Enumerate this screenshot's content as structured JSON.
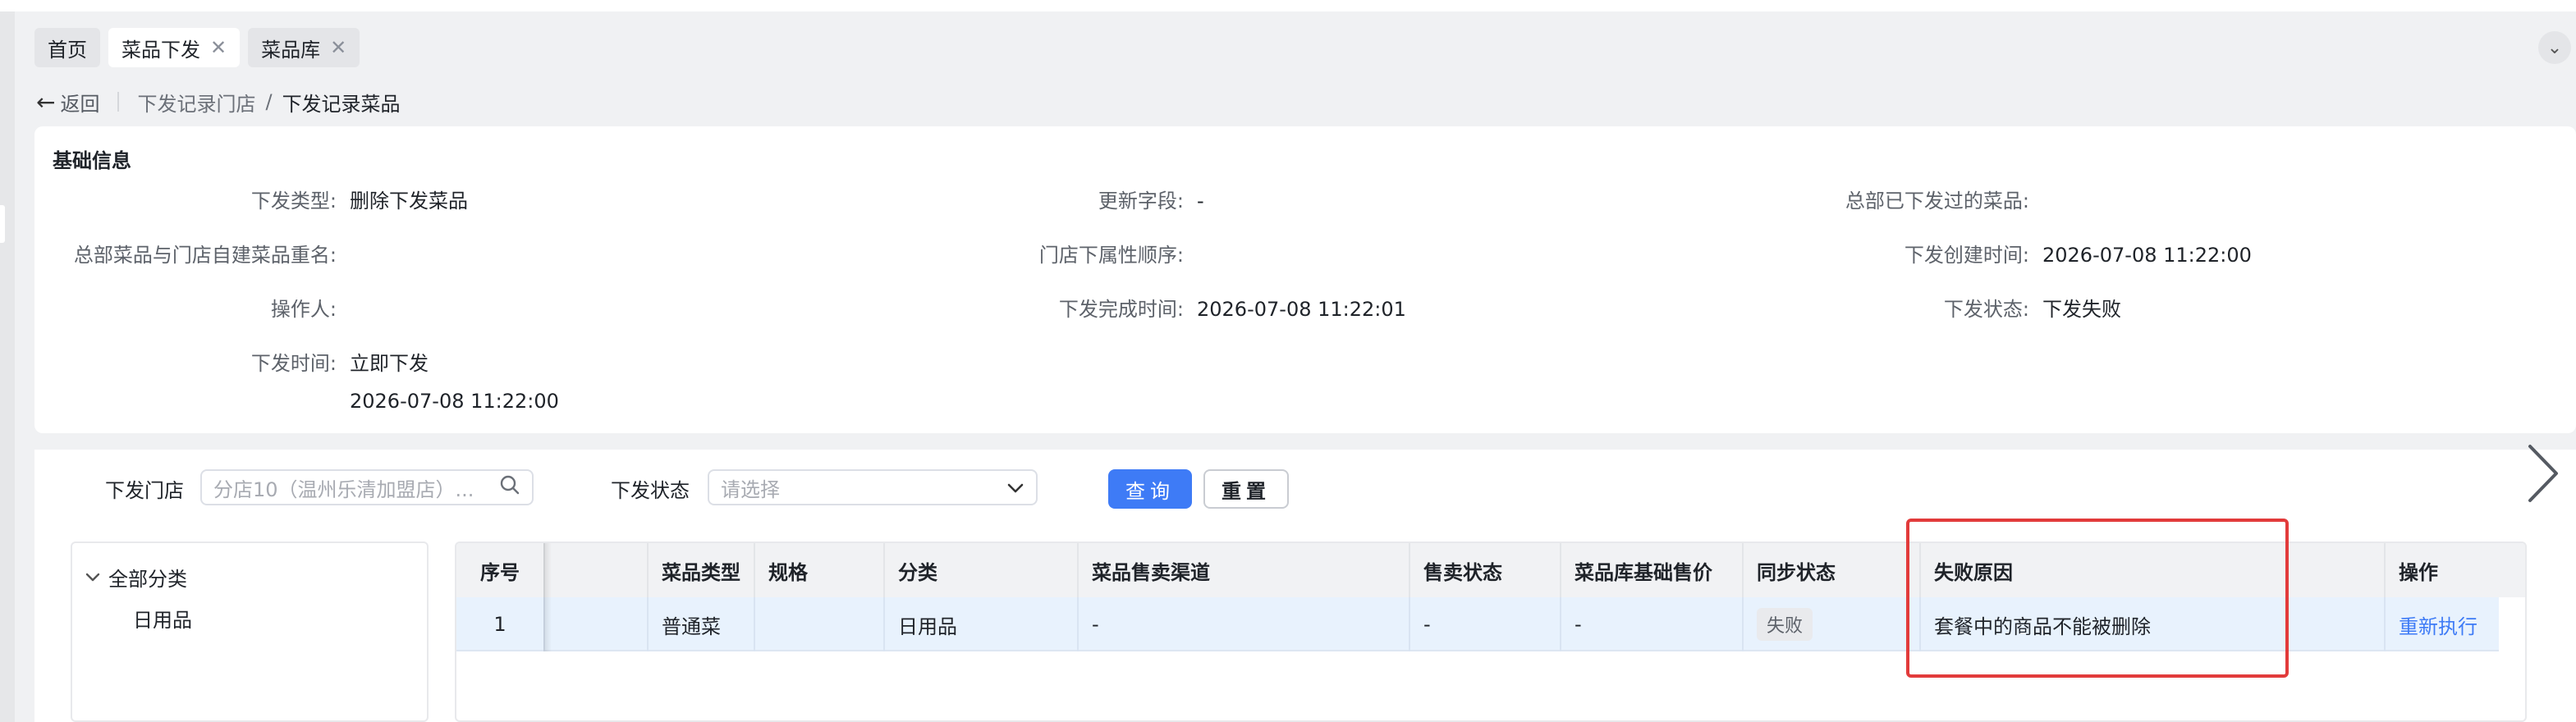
{
  "tabs": [
    {
      "label": "首页",
      "closable": false
    },
    {
      "label": "菜品下发",
      "closable": true
    },
    {
      "label": "菜品库",
      "closable": true
    }
  ],
  "breadcrumb": {
    "back_label": "返回",
    "parent": "下发记录门店",
    "separator": "/",
    "current": "下发记录菜品"
  },
  "basic_info": {
    "title": "基础信息",
    "fields": {
      "dispatch_type": {
        "label": "下发类型:",
        "value": "删除下发菜品"
      },
      "update_fields": {
        "label": "更新字段:",
        "value": "-"
      },
      "hq_dispatched_dishes": {
        "label": "总部已下发过的菜品:",
        "value": ""
      },
      "rename_conflict": {
        "label": "总部菜品与门店自建菜品重名:",
        "value": ""
      },
      "store_attr_order": {
        "label": "门店下属性顺序:",
        "value": ""
      },
      "created_time": {
        "label": "下发创建时间:",
        "value": "2026-07-08 11:22:00"
      },
      "operator": {
        "label": "操作人:",
        "value": ""
      },
      "finished_time": {
        "label": "下发完成时间:",
        "value": "2026-07-08 11:22:01"
      },
      "status": {
        "label": "下发状态:",
        "value": "下发失败"
      },
      "dispatch_time": {
        "label": "下发时间:",
        "value_line1": "立即下发",
        "value_line2": "2026-07-08 11:22:00"
      }
    }
  },
  "filters": {
    "store_label": "下发门店",
    "store_value": "分店10（温州乐清加盟店）...",
    "status_label": "下发状态",
    "status_placeholder": "请选择",
    "query_button": "查询",
    "reset_button": "重置"
  },
  "category_tree": {
    "root": "全部分类",
    "children": [
      "日用品"
    ]
  },
  "table": {
    "columns": [
      "序号",
      "菜品类型",
      "规格",
      "分类",
      "菜品售卖渠道",
      "售卖状态",
      "菜品库基础售价",
      "同步状态",
      "失败原因",
      "操作"
    ],
    "rows": [
      {
        "index": "1",
        "dish_type": "普通菜",
        "spec": "",
        "category": "日用品",
        "channel": "-",
        "sale_status": "-",
        "base_price": "-",
        "sync_status": "失败",
        "fail_reason": "套餐中的商品不能被删除",
        "action": "重新执行"
      }
    ]
  },
  "colors": {
    "primary": "#3e7bf6",
    "highlight_border": "#e23b3b",
    "row_selected": "#e8f2fd"
  }
}
